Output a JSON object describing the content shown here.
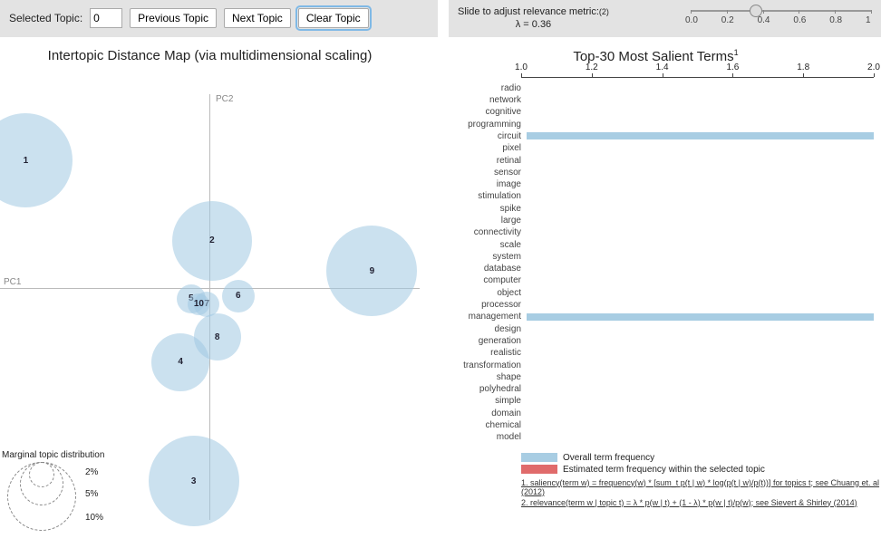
{
  "controls": {
    "selected_label": "Selected Topic:",
    "selected_value": "0",
    "prev": "Previous Topic",
    "next": "Next Topic",
    "clear": "Clear Topic"
  },
  "lambda": {
    "header": "Slide to adjust relevance metric:",
    "note": "(2)",
    "value_label": "λ = 0.36",
    "value": 0.36,
    "ticks": [
      "0.0",
      "0.2",
      "0.4",
      "0.6",
      "0.8",
      "1"
    ]
  },
  "left_title": "Intertopic Distance Map (via multidimensional scaling)",
  "axes": {
    "pc1": "PC1",
    "pc2": "PC2"
  },
  "marginal": {
    "title": "Marginal topic distribution",
    "levels": [
      "2%",
      "5%",
      "10%"
    ]
  },
  "right_title_main": "Top-30 Most Salient Terms",
  "right_title_sup": "1",
  "xscale": {
    "min": 1.0,
    "max": 2.0,
    "ticks": [
      "1.0",
      "1.2",
      "1.4",
      "1.6",
      "1.8",
      "2.0"
    ]
  },
  "legend": {
    "overall": "Overall term frequency",
    "within": "Estimated term frequency within the selected topic"
  },
  "footnotes": {
    "a": "1. saliency(term w) = frequency(w) * [sum_t p(t | w) * log(p(t | w)/p(t))] for topics t; see Chuang et. al (2012)",
    "b": "2. relevance(term w | topic t) = λ * p(w | t) + (1 - λ) * p(w | t)/p(w); see Sievert & Shirley (2014)"
  },
  "chart_data": {
    "type": "custom",
    "mds": {
      "xrange": [
        -4,
        4
      ],
      "yrange": [
        -4,
        4
      ],
      "bubbles": [
        {
          "id": "1",
          "x": -3.5,
          "y": 2.3,
          "r": 52
        },
        {
          "id": "2",
          "x": 0.05,
          "y": 0.85,
          "r": 44
        },
        {
          "id": "3",
          "x": -0.3,
          "y": -3.5,
          "r": 50
        },
        {
          "id": "4",
          "x": -0.55,
          "y": -1.35,
          "r": 32
        },
        {
          "id": "5",
          "x": -0.35,
          "y": -0.2,
          "r": 16
        },
        {
          "id": "6",
          "x": 0.55,
          "y": -0.15,
          "r": 18
        },
        {
          "id": "7",
          "x": -0.05,
          "y": -0.3,
          "r": 14
        },
        {
          "id": "8",
          "x": 0.15,
          "y": -0.9,
          "r": 26
        },
        {
          "id": "9",
          "x": 3.1,
          "y": 0.3,
          "r": 50
        },
        {
          "id": "10",
          "x": -0.2,
          "y": -0.3,
          "r": 12
        }
      ]
    },
    "bars": {
      "xmin": 1.0,
      "xmax": 2.0,
      "terms": [
        {
          "term": "radio",
          "v": 1.0
        },
        {
          "term": "network",
          "v": 1.0
        },
        {
          "term": "cognitive",
          "v": 1.0
        },
        {
          "term": "programming",
          "v": 1.0
        },
        {
          "term": "circuit",
          "v": 2.0
        },
        {
          "term": "pixel",
          "v": 1.0
        },
        {
          "term": "retinal",
          "v": 1.0
        },
        {
          "term": "sensor",
          "v": 1.0
        },
        {
          "term": "image",
          "v": 1.0
        },
        {
          "term": "stimulation",
          "v": 1.0
        },
        {
          "term": "spike",
          "v": 1.0
        },
        {
          "term": "large",
          "v": 1.0
        },
        {
          "term": "connectivity",
          "v": 1.0
        },
        {
          "term": "scale",
          "v": 1.0
        },
        {
          "term": "system",
          "v": 1.0
        },
        {
          "term": "database",
          "v": 1.0
        },
        {
          "term": "computer",
          "v": 1.0
        },
        {
          "term": "object",
          "v": 1.0
        },
        {
          "term": "processor",
          "v": 1.0
        },
        {
          "term": "management",
          "v": 2.0
        },
        {
          "term": "design",
          "v": 1.0
        },
        {
          "term": "generation",
          "v": 1.0
        },
        {
          "term": "realistic",
          "v": 1.0
        },
        {
          "term": "transformation",
          "v": 1.0
        },
        {
          "term": "shape",
          "v": 1.0
        },
        {
          "term": "polyhedral",
          "v": 1.0
        },
        {
          "term": "simple",
          "v": 1.0
        },
        {
          "term": "domain",
          "v": 1.0
        },
        {
          "term": "chemical",
          "v": 1.0
        },
        {
          "term": "model",
          "v": 1.0
        }
      ]
    }
  }
}
